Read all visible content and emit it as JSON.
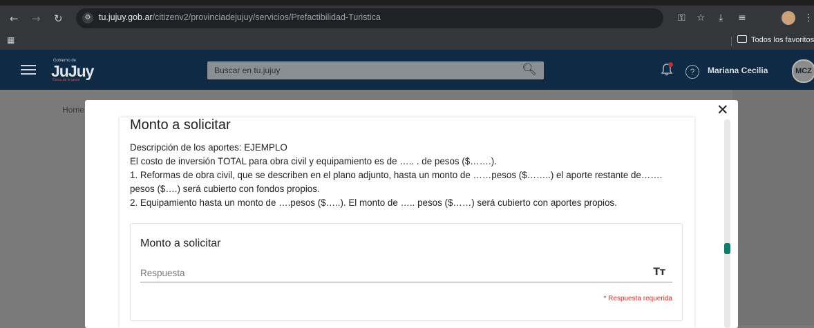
{
  "browser": {
    "url_host": "tu.jujuy.gob.ar",
    "url_path": "/citizenv2/provinciadejujuy/servicios/Prefactibilidad-Turistica",
    "bookmarks_folder": "Todos los favoritos"
  },
  "site": {
    "logo_top": "Gobierno de",
    "logo": "JuJuy",
    "logo_tag": "Cerca de la gente",
    "search_placeholder": "Buscar en tu.jujuy",
    "user_name": "Mariana Cecilia",
    "avatar_initials": "MCZ",
    "breadcrumb_home": "Home"
  },
  "modal": {
    "close_glyph": "✕",
    "section_title": "Monto a solicitar",
    "description_lines": [
      "Descripción de los aportes: EJEMPLO",
      "El costo de inversión TOTAL para obra civil y equipamiento es de ….. . de pesos ($…….).",
      "1. Reformas de obra civil, que se describen en el plano adjunto, hasta un monto de ……pesos ($……..) el aporte restante de…….",
      "pesos ($….)  será cubierto con fondos propios.",
      "2. Equipamiento hasta un monto de ….pesos ($…..). El monto de  ….. pesos ($……) será cubierto con aportes propios."
    ],
    "question": {
      "title": "Monto a solicitar",
      "placeholder": "Respuesta",
      "value": "",
      "required_text": "* Respuesta requerida"
    }
  },
  "colors": {
    "site_header": "#0e2a45",
    "scroll_thumb": "#127a6b",
    "required": "#d42b2b"
  },
  "icons": [
    "back-icon",
    "forward-icon",
    "reload-icon",
    "site-settings-icon",
    "password-key-icon",
    "star-icon",
    "download-icon",
    "media-icon",
    "profile-icon",
    "menu-dots-icon",
    "apps-icon",
    "folder-icon",
    "hamburger-icon",
    "search-icon",
    "bell-icon",
    "help-icon",
    "close-icon",
    "text-format-icon"
  ]
}
